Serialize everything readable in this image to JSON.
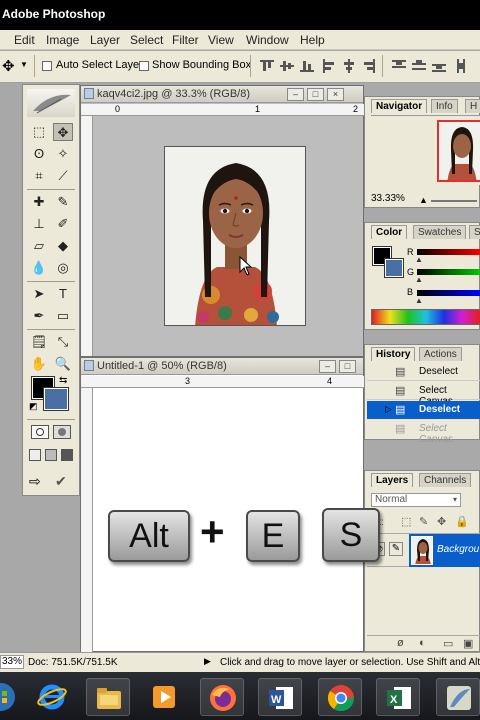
{
  "window": {
    "title": "Adobe Photoshop"
  },
  "menu": {
    "items": [
      "Edit",
      "Image",
      "Layer",
      "Select",
      "Filter",
      "View",
      "Window",
      "Help"
    ]
  },
  "options": {
    "auto_select_label": "Auto Select Layer",
    "show_bounding_label": "Show Bounding Box"
  },
  "doc1": {
    "title": "kaqv4ci2.jpg @ 33.3% (RGB/8)",
    "ruler_marks": [
      "0",
      "1",
      "2"
    ]
  },
  "doc2": {
    "title": "Untitled-1 @ 50% (RGB/8)",
    "ruler_marks": [
      "3",
      "4"
    ]
  },
  "navigator": {
    "tabs": [
      "Navigator",
      "Info",
      "H"
    ],
    "zoom": "33.33%"
  },
  "color": {
    "tabs": [
      "Color",
      "Swatches",
      "S"
    ],
    "channels": [
      "R",
      "G",
      "B"
    ]
  },
  "history": {
    "tabs": [
      "History",
      "Actions"
    ],
    "items": [
      "Deselect",
      "Select Canvas",
      "Deselect",
      "Select Canvas"
    ]
  },
  "layers": {
    "tabs": [
      "Layers",
      "Channels"
    ],
    "blend_mode": "Normal",
    "lock_label": "ck:",
    "layer_name": "Backgrou"
  },
  "shortcut": {
    "key1": "Alt",
    "plus": "+",
    "key2": "E",
    "key3": "S"
  },
  "status": {
    "zoom": "33%",
    "doc_size": "Doc: 751.5K/751.5K",
    "hint": "Click and drag to move layer or selection.  Use Shift and Alt fo"
  },
  "colors": {
    "accent_blue": "#0a5ec9",
    "fg_color": "#000000",
    "bg_color": "#4a6fa5"
  }
}
